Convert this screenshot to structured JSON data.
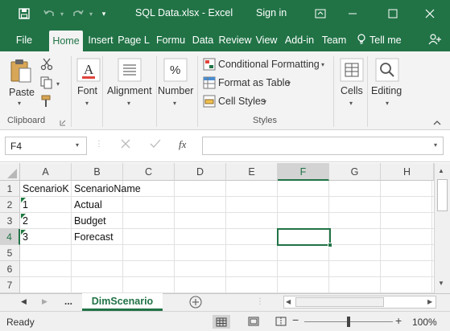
{
  "window": {
    "title": "SQL Data.xlsx  -  Excel",
    "signin": "Sign in"
  },
  "tabs": [
    {
      "label": "File"
    },
    {
      "label": "Home"
    },
    {
      "label": "Insert"
    },
    {
      "label": "Page L"
    },
    {
      "label": "Formu"
    },
    {
      "label": "Data"
    },
    {
      "label": "Review"
    },
    {
      "label": "View"
    },
    {
      "label": "Add-in"
    },
    {
      "label": "Team"
    },
    {
      "label": "Tell me"
    }
  ],
  "ribbon": {
    "clipboard": {
      "paste": "Paste",
      "group": "Clipboard"
    },
    "font": "Font",
    "alignment": "Alignment",
    "number": "Number",
    "styles": {
      "conditional": "Conditional Formatting",
      "format_table": "Format as Table",
      "cell_styles": "Cell Styles",
      "group": "Styles"
    },
    "cells": "Cells",
    "editing": "Editing"
  },
  "formula_bar": {
    "name_box": "F4",
    "fx": "fx",
    "value": ""
  },
  "grid": {
    "columns": [
      "A",
      "B",
      "C",
      "D",
      "E",
      "F",
      "G",
      "H"
    ],
    "selected_column": "F",
    "rows": [
      "1",
      "2",
      "3",
      "4",
      "5",
      "6",
      "7"
    ],
    "selected_row": "4",
    "cells": {
      "A1": "ScenarioK",
      "B1": "ScenarioName",
      "A2": "1",
      "B2": "Actual",
      "A3": "2",
      "B3": "Budget",
      "A4": "3",
      "B4": "Forecast"
    }
  },
  "sheets": {
    "more": "...",
    "active": "DimScenario"
  },
  "status": {
    "ready": "Ready",
    "zoom": "100%"
  },
  "colors": {
    "accent": "#217346"
  }
}
